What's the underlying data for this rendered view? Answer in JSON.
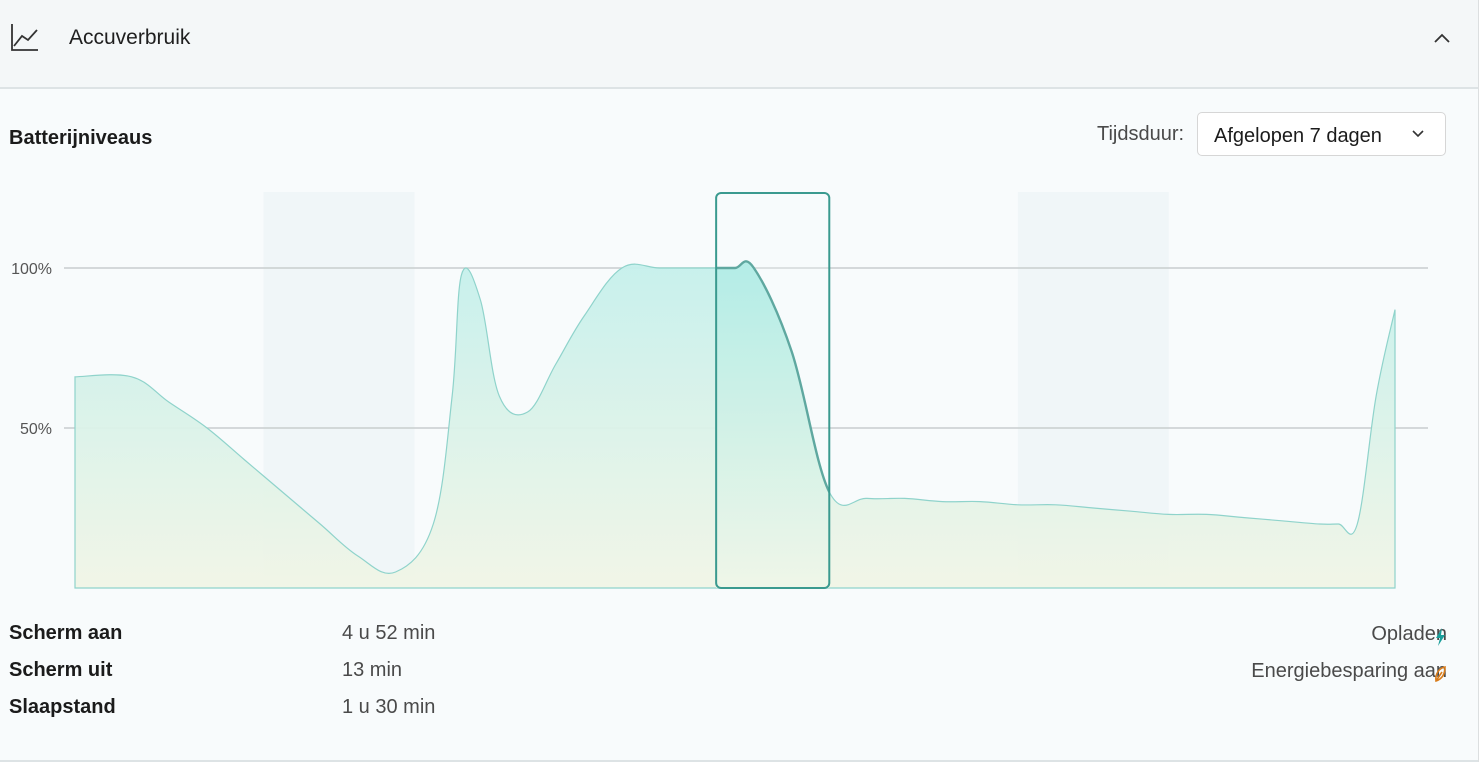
{
  "header": {
    "title": "Accuverbruik",
    "icon": "line-chart-icon",
    "collapse_icon": "chevron-up-icon"
  },
  "section": {
    "title": "Batterijniveaus"
  },
  "duration": {
    "label": "Tijdsduur:",
    "selected": "Afgelopen 7 dagen",
    "icon": "chevron-down-icon"
  },
  "chart_data": {
    "type": "area",
    "y_ticks": [
      "100%",
      "50%"
    ],
    "ylim": [
      0,
      100
    ],
    "grid": true,
    "series": [
      {
        "x": [
          0,
          6,
          10,
          14,
          18,
          22,
          26,
          30,
          34,
          38,
          40,
          41,
          43,
          45,
          48,
          51,
          54,
          58,
          62,
          66,
          68,
          70,
          72,
          76,
          80,
          84,
          88,
          92,
          96,
          100,
          104,
          108,
          112,
          116,
          120,
          124,
          128,
          132,
          134,
          136,
          138,
          140
        ],
        "y": [
          66,
          66,
          58,
          50,
          40,
          30,
          20,
          10,
          5,
          20,
          60,
          98,
          90,
          60,
          55,
          70,
          85,
          100,
          100,
          100,
          100,
          100,
          100,
          74,
          30,
          28,
          28,
          27,
          27,
          26,
          26,
          25,
          24,
          23,
          23,
          22,
          21,
          20,
          20,
          20,
          60,
          87
        ]
      }
    ],
    "selected_range": [
      68,
      80
    ],
    "shaded_ranges": [
      [
        20,
        36
      ],
      [
        100,
        116
      ]
    ]
  },
  "stats": [
    {
      "label": "Scherm aan",
      "value": "4 u 52 min"
    },
    {
      "label": "Scherm uit",
      "value": "13 min"
    },
    {
      "label": "Slaapstand",
      "value": "1 u 30 min"
    }
  ],
  "legend": [
    {
      "label": "Opladen",
      "icon": "lightning-icon",
      "color": "#1a9e9a"
    },
    {
      "label": "Energiebesparing aan",
      "icon": "leaf-icon",
      "color": "#d97c1a"
    }
  ],
  "colors": {
    "accent": "#3a9a8f",
    "fill": "#bfeee9",
    "grid": "#c8cdce"
  }
}
